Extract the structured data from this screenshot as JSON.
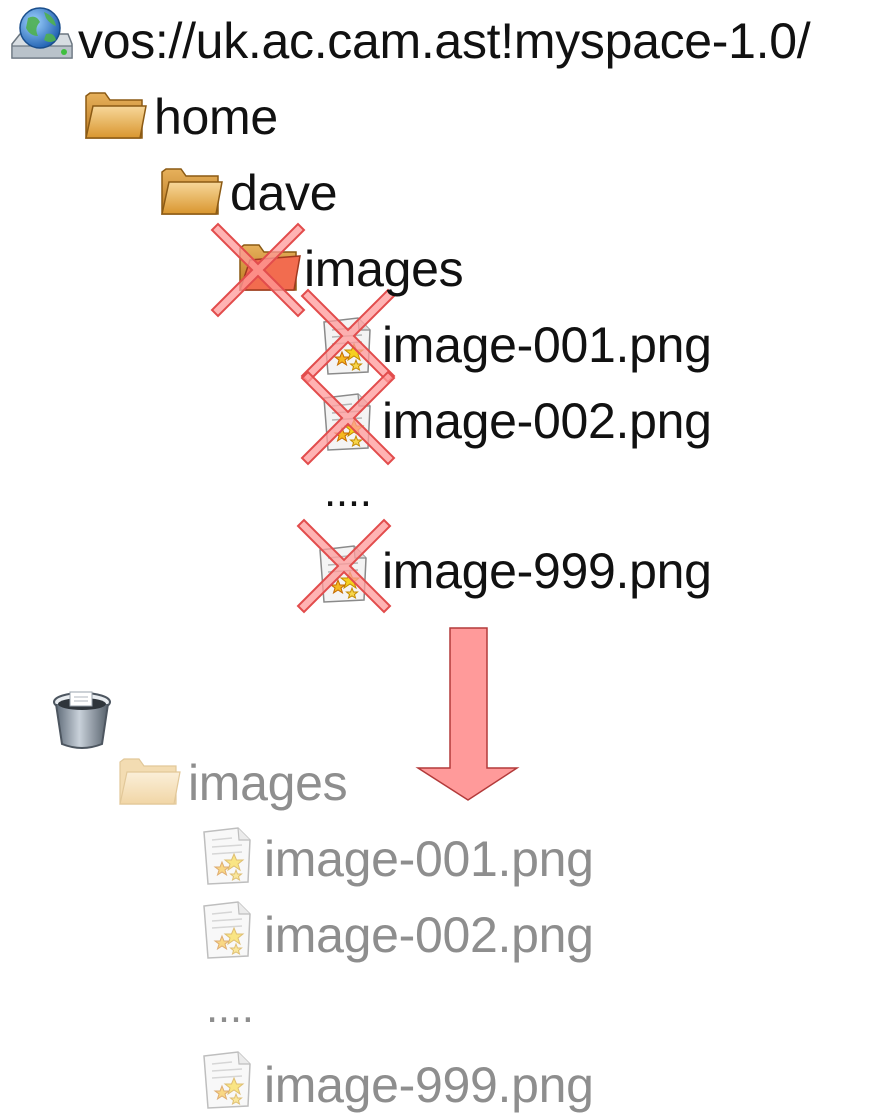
{
  "source_tree": {
    "root": {
      "label": "vos://uk.ac.cam.ast!myspace-1.0/",
      "icon": "network-drive-globe-icon"
    },
    "home": {
      "label": "home",
      "icon": "folder-icon"
    },
    "dave": {
      "label": "dave",
      "icon": "folder-icon"
    },
    "images": {
      "label": "images",
      "icon": "folder-icon",
      "marked": "deleted"
    },
    "files": [
      {
        "label": "image-001.png",
        "icon": "image-file-icon",
        "marked": "deleted"
      },
      {
        "label": "image-002.png",
        "icon": "image-file-icon",
        "marked": "deleted"
      },
      {
        "label": "....",
        "icon": ""
      },
      {
        "label": "image-999.png",
        "icon": "image-file-icon",
        "marked": "deleted"
      }
    ]
  },
  "trash_tree": {
    "trash": {
      "icon": "trash-can-icon"
    },
    "images": {
      "label": "images",
      "icon": "folder-icon"
    },
    "files": [
      {
        "label": "image-001.png",
        "icon": "image-file-icon"
      },
      {
        "label": "image-002.png",
        "icon": "image-file-icon"
      },
      {
        "label": "....",
        "icon": ""
      },
      {
        "label": "image-999.png",
        "icon": "image-file-icon"
      }
    ]
  },
  "colors": {
    "text": "#111111",
    "ghost_text": "#8e8e8e",
    "cross": "#e24c4c",
    "cross_fill": "#ff9a9a",
    "arrow_fill": "#ff9a9a",
    "arrow_stroke": "#b33a3a",
    "folder": "#f0b75a",
    "folder_open": "#f26c4f"
  }
}
